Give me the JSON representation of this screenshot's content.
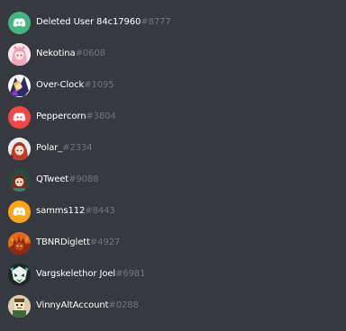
{
  "colors": {
    "background": "#36393f",
    "username": "#ffffff",
    "discriminator": "#72767d"
  },
  "members": [
    {
      "username": "Deleted User 84c17960",
      "discriminator": "#8777",
      "avatar": "discord-logo-icon",
      "avatar_color": "#43b581"
    },
    {
      "username": "Nekotina",
      "discriminator": "#0608",
      "avatar": "anime-girl-avatar",
      "avatar_color": "#f3c7d2"
    },
    {
      "username": "Over-Clock",
      "discriminator": "#1095",
      "avatar": "character-avatar",
      "avatar_color": "#2a2a55"
    },
    {
      "username": "Peppercorn",
      "discriminator": "#3804",
      "avatar": "discord-logo-icon",
      "avatar_color": "#f04747"
    },
    {
      "username": "Polar_",
      "discriminator": "#2334",
      "avatar": "character-avatar",
      "avatar_color": "#d9d9d9"
    },
    {
      "username": "QTweet",
      "discriminator": "#9088",
      "avatar": "character-avatar",
      "avatar_color": "#1f3a33"
    },
    {
      "username": "samms112",
      "discriminator": "#8443",
      "avatar": "discord-logo-icon",
      "avatar_color": "#faa61a"
    },
    {
      "username": "TBNRDiglett",
      "discriminator": "#4927",
      "avatar": "character-avatar",
      "avatar_color": "#d3501c"
    },
    {
      "username": "Vargskelethor Joel",
      "discriminator": "#6981",
      "avatar": "character-avatar",
      "avatar_color": "#1b2b2a"
    },
    {
      "username": "VinnyAltAccount",
      "discriminator": "#0288",
      "avatar": "character-avatar",
      "avatar_color": "#c8b493"
    }
  ]
}
